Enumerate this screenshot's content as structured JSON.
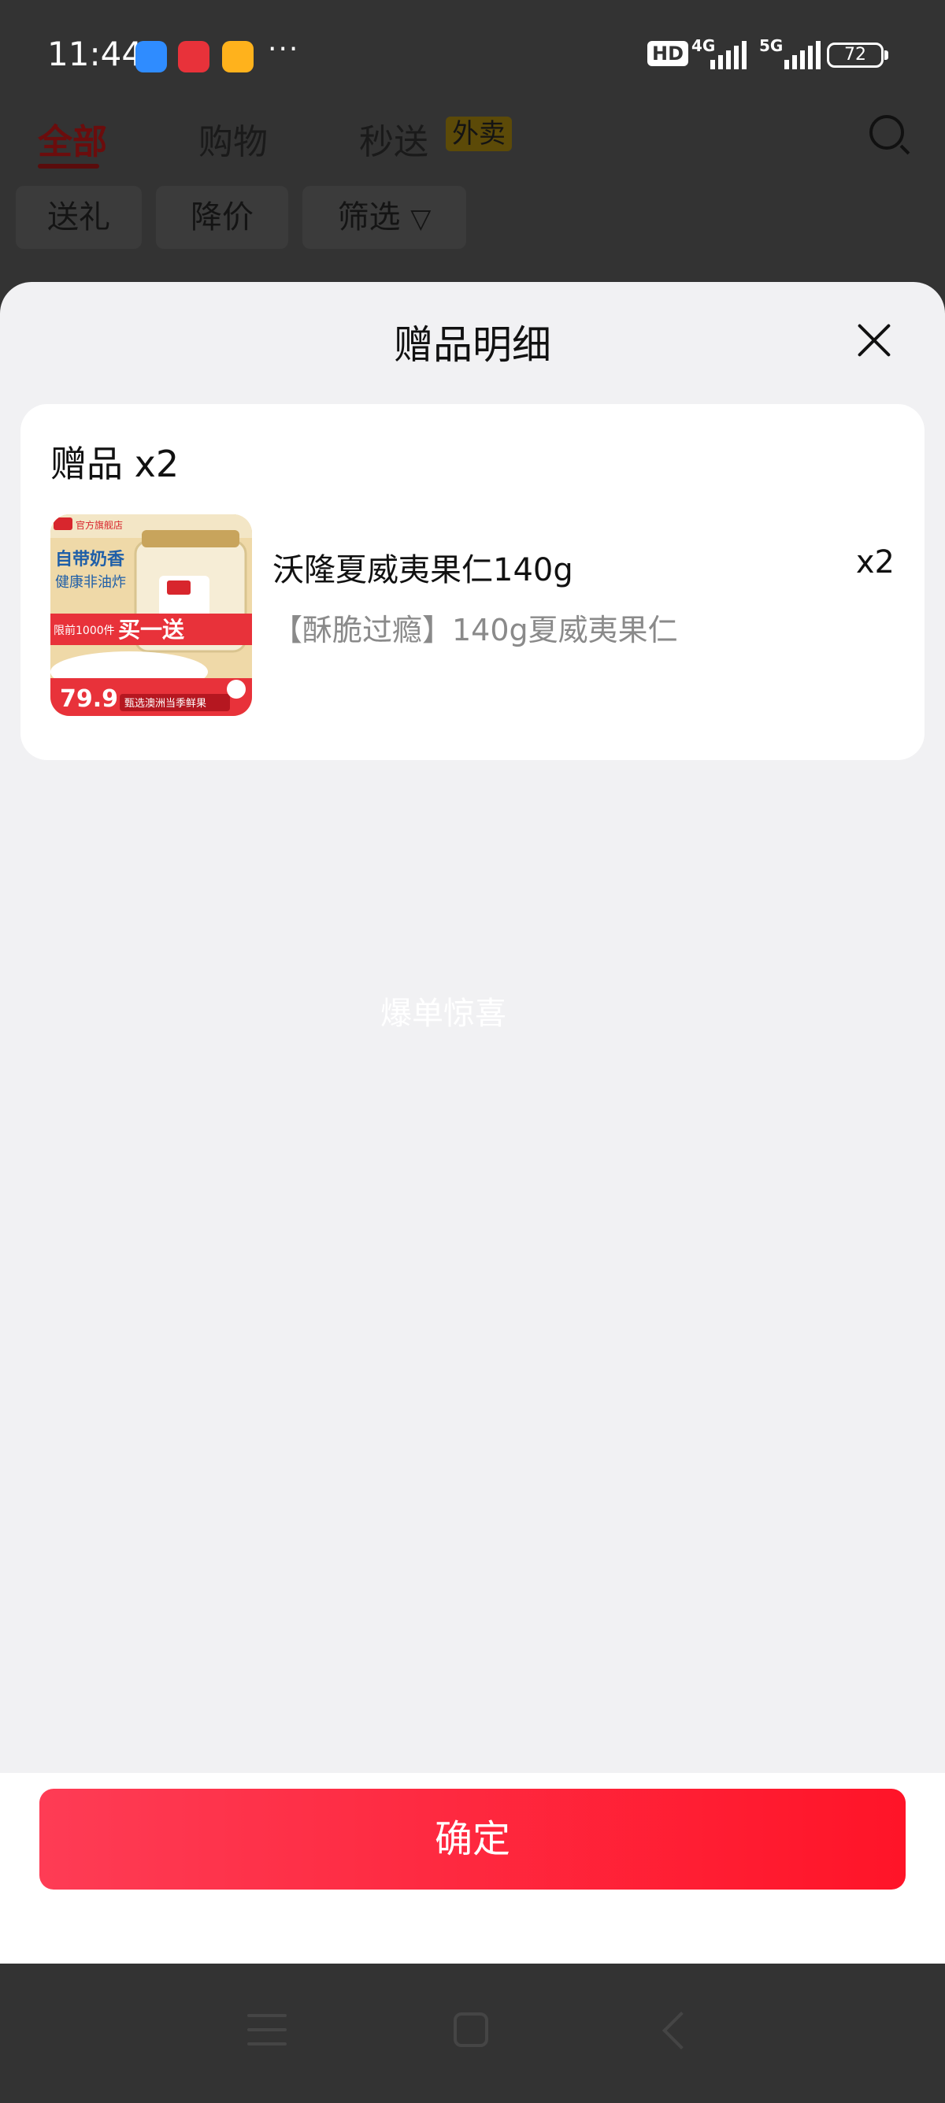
{
  "status_bar": {
    "time": "11:44",
    "more": "···",
    "hd_label": "HD",
    "sim1_label": "4G",
    "sim2_label": "5G",
    "battery": "72"
  },
  "top_tabs": {
    "all": "全部",
    "shopping": "购物",
    "instant": "秒送",
    "takeout_badge": "外卖"
  },
  "filters": {
    "gift": "送礼",
    "price_drop": "降价",
    "filter": "筛选"
  },
  "sheet": {
    "title": "赠品明细",
    "gift_header": "赠品 x2",
    "product": {
      "name": "沃隆夏威夷果仁140g",
      "quantity": "x2",
      "spec": "【酥脆过瘾】140g夏威夷果仁",
      "image": {
        "store_tag": "官方旗舰店",
        "slogan1": "自带奶香",
        "slogan2": "健康非油炸",
        "promo_left": "限前1000件",
        "promo": "买一送",
        "price": "79.9",
        "bottom_text": "甄选澳洲当季鲜果"
      }
    },
    "watermark": "爆单惊喜",
    "confirm_label": "确定"
  },
  "colors": {
    "accent": "#ff1428",
    "accent_start": "#fe3c55",
    "sheet_bg": "#f1f1f3",
    "overlay": "#333333"
  }
}
